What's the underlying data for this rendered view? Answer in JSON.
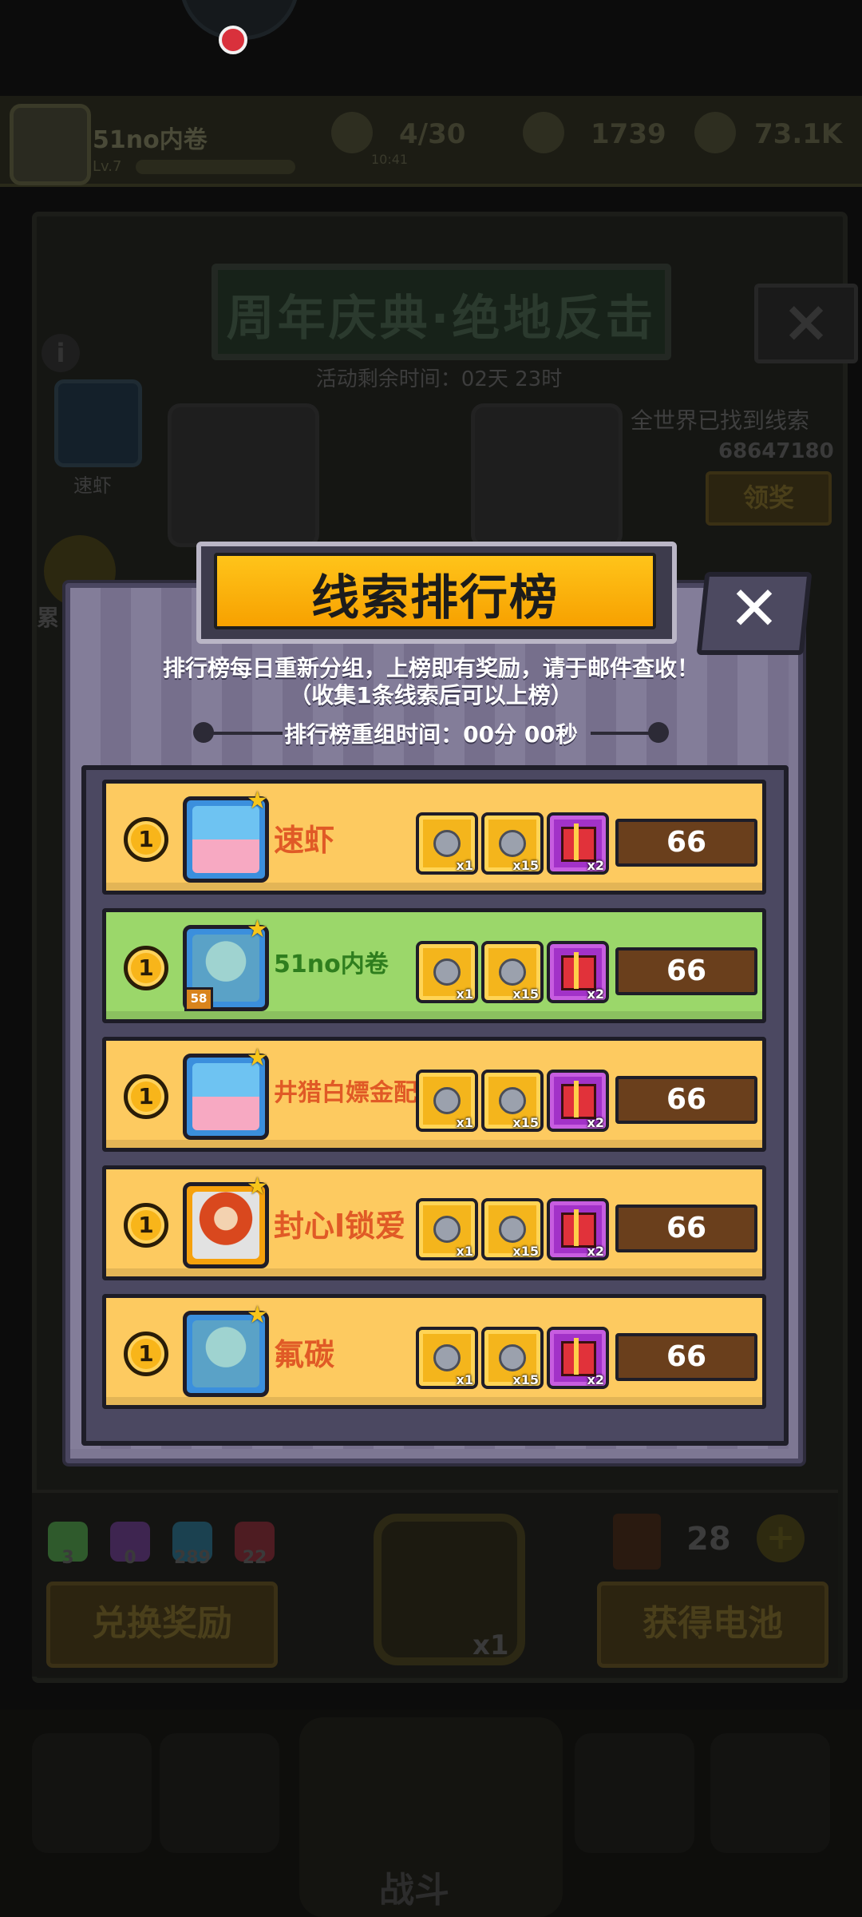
{
  "background": {
    "player_name": "51no内卷",
    "player_level": "Lv.7",
    "stat_energy": "4/30",
    "stat_energy_timer": "10:41",
    "stat_coins": "1739",
    "stat_gold": "73.1K",
    "event_title": "周年庆典·绝地反击",
    "event_timer": "活动剩余时间：02天 23时",
    "left_player_name": "速虾",
    "found_label": "全世界已找到线索",
    "found_count": "68647180",
    "claim_button": "领奖",
    "left_side_label": "累",
    "gems": [
      {
        "count": "3",
        "color": "#2f5a2c"
      },
      {
        "count": "0",
        "color": "#3e2550"
      },
      {
        "count": "289",
        "color": "#1b4150"
      },
      {
        "count": "22",
        "color": "#4e1c22"
      }
    ],
    "exchange_button": "兑换奖励",
    "battery_button": "获得电池",
    "battery_count": "28",
    "lock_multiplier": "x1",
    "nav_battle_label": "战斗"
  },
  "modal": {
    "title": "线索排行榜",
    "description_line1": "排行榜每日重新分组，上榜即有奖励，请于邮件查收！",
    "description_line2": "（收集1条线索后可以上榜）",
    "reset_label": "排行榜重组时间：00分 00秒",
    "close_icon": "close-icon",
    "rows": [
      {
        "rank": "1",
        "name": "速虾",
        "avatar": "cake-avatar",
        "highlight": false,
        "rewards": [
          "x1",
          "x15",
          "x2"
        ],
        "score": "66"
      },
      {
        "rank": "1",
        "name": "51no内卷",
        "avatar": "squid-avatar",
        "level": "58",
        "highlight": true,
        "rewards": [
          "x1",
          "x15",
          "x2"
        ],
        "score": "66"
      },
      {
        "rank": "1",
        "name": "井猎白嫖金配",
        "avatar": "cake-avatar",
        "highlight": false,
        "rewards": [
          "x1",
          "x15",
          "x2"
        ],
        "score": "66"
      },
      {
        "rank": "1",
        "name": "封心l锁爱",
        "avatar": "redhair-avatar",
        "highlight": false,
        "rewards": [
          "x1",
          "x15",
          "x2"
        ],
        "score": "66"
      },
      {
        "rank": "1",
        "name": "氟碳",
        "avatar": "squid-avatar",
        "highlight": false,
        "rewards": [
          "x1",
          "x15",
          "x2"
        ],
        "score": "66"
      }
    ]
  },
  "colors": {
    "row_gold": "#fdca60",
    "row_highlight": "#9bd76a",
    "title_bar": "#f7a100",
    "score_bg": "#6a3f1c"
  }
}
